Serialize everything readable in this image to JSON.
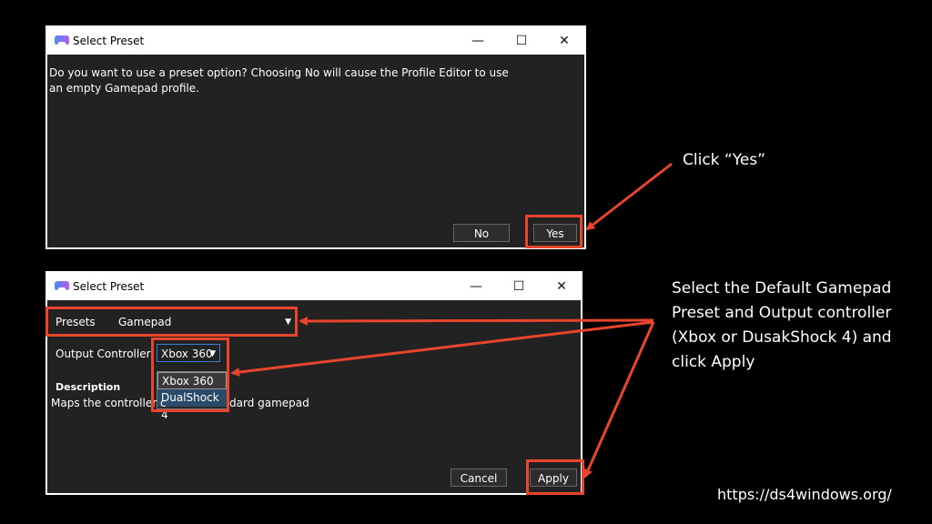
{
  "dialog1": {
    "title": "Select Preset",
    "message": "Do you want to use a preset option? Choosing No will cause the Profile Editor to use an empty Gamepad profile.",
    "no_label": "No",
    "yes_label": "Yes"
  },
  "dialog2": {
    "title": "Select Preset",
    "presets_label": "Presets",
    "presets_value": "Gamepad",
    "output_label": "Output Controller:",
    "output_value": "Xbox 360",
    "output_options": [
      "Xbox 360",
      "DualShock 4"
    ],
    "description_label": "Description",
    "description_text_left": "Maps the controller c",
    "description_text_right": "dard gamepad",
    "cancel_label": "Cancel",
    "apply_label": "Apply"
  },
  "window_controls": {
    "minimize": "—",
    "maximize": "☐",
    "close": "✕"
  },
  "annotations": {
    "click_yes": "Click “Yes”",
    "select_default": "Select the Default Gamepad Preset and Output controller (Xbox or DusakShock 4) and click Apply",
    "url": "https://ds4windows.org/"
  },
  "colors": {
    "highlight": "#e8452c",
    "dialog_bg": "#222222",
    "page_bg": "#000000"
  }
}
